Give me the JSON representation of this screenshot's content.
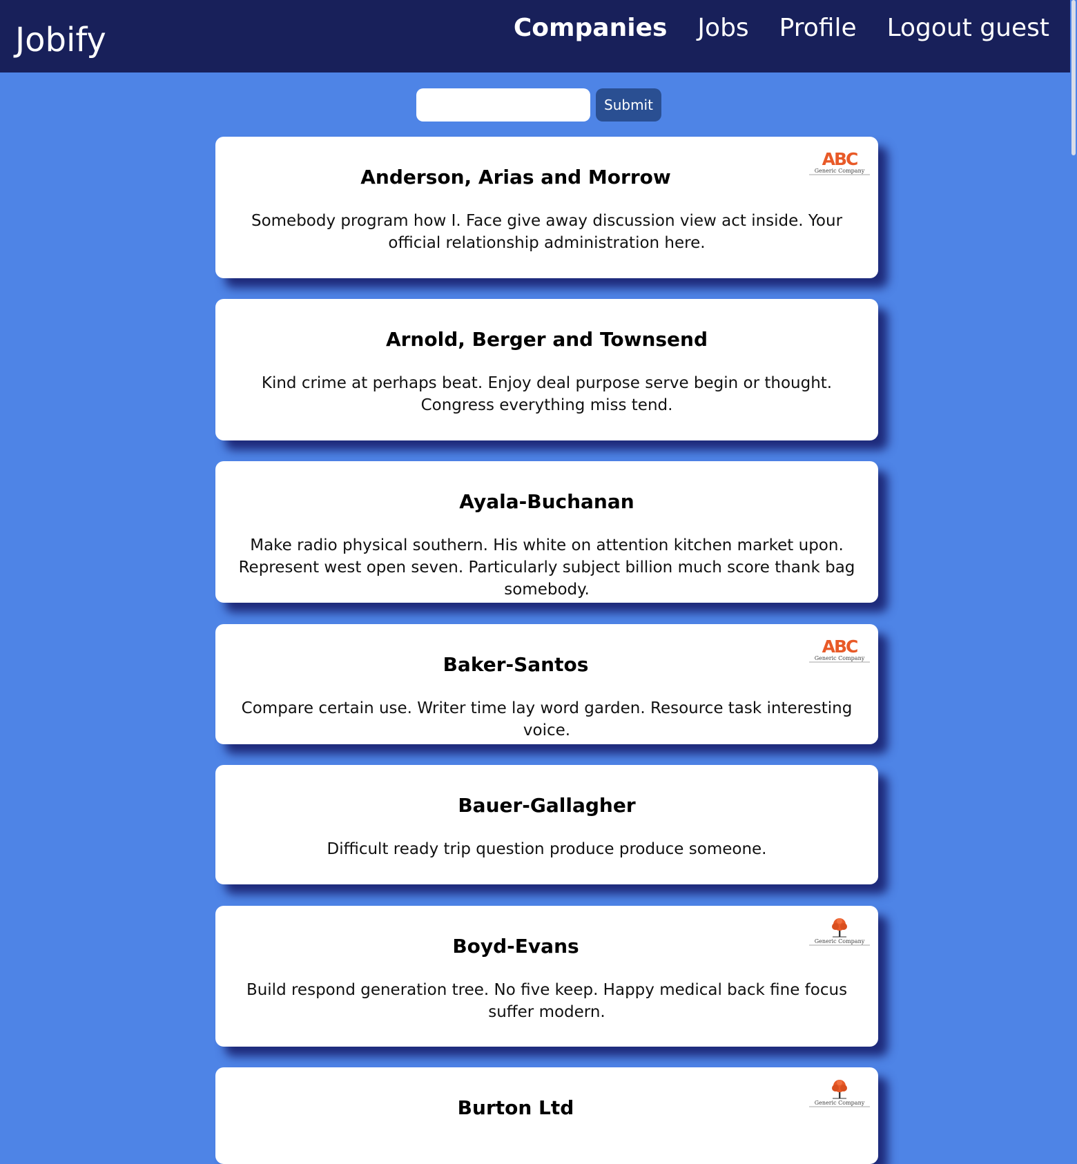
{
  "nav": {
    "brand": "Jobify",
    "links": [
      {
        "label": "Companies",
        "active": true
      },
      {
        "label": "Jobs",
        "active": false
      },
      {
        "label": "Profile",
        "active": false
      },
      {
        "label": "Logout guest",
        "active": false
      }
    ]
  },
  "search": {
    "value": "",
    "placeholder": "",
    "submit_label": "Submit"
  },
  "companies": [
    {
      "name": "Anderson, Arias and Morrow",
      "description": "Somebody program how I. Face give away discussion view act inside. Your official relationship administration here.",
      "logo": "abc-logo",
      "logo_text": "Generic Company"
    },
    {
      "name": "Arnold, Berger and Townsend",
      "description": "Kind crime at perhaps beat. Enjoy deal purpose serve begin or thought. Congress everything miss tend.",
      "logo": null
    },
    {
      "name": "Ayala-Buchanan",
      "description": "Make radio physical southern. His white on attention kitchen market upon. Represent west open seven. Particularly subject billion much score thank bag somebody.",
      "logo": null
    },
    {
      "name": "Baker-Santos",
      "description": "Compare certain use. Writer time lay word garden. Resource task interesting voice.",
      "logo": "abc-logo",
      "logo_text": "Generic Company"
    },
    {
      "name": "Bauer-Gallagher",
      "description": "Difficult ready trip question produce produce someone.",
      "logo": null
    },
    {
      "name": "Boyd-Evans",
      "description": "Build respond generation tree. No five keep. Happy medical back fine focus suffer modern.",
      "logo": "tree-logo",
      "logo_text": "Generic Company"
    },
    {
      "name": "Burton Ltd",
      "description": "",
      "logo": "tree-logo",
      "logo_text": "Generic Company"
    }
  ],
  "colors": {
    "nav_bg": "#18205a",
    "page_bg": "#4e84e6",
    "submit_bg": "#2a4f92",
    "logo_orange": "#e85a28"
  }
}
